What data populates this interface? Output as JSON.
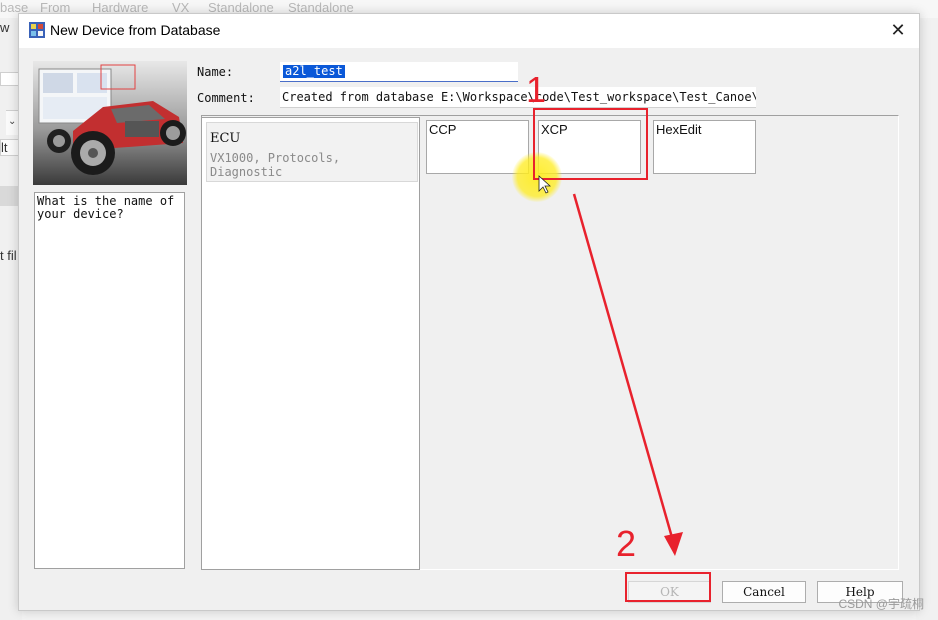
{
  "background_app": {
    "toolbar_items": [
      "base",
      "From",
      "Hardware",
      "VX",
      "Standalone",
      "Standalone"
    ],
    "left_fragments": [
      "w",
      "lt",
      "t fil"
    ]
  },
  "dialog": {
    "title": "New Device from Database",
    "close_glyph": "✕",
    "name_label": "Name:",
    "name_value": "a2l_test",
    "comment_label": "Comment:",
    "comment_value": "Created from database E:\\Workspace\\code\\Test_workspace\\Test_Canoe\\P",
    "help_text": "What is the name of\nyour device?",
    "categories": [
      {
        "title": "ECU",
        "subtitle": "VX1000, Protocols, Diagnostic"
      }
    ],
    "protocols": [
      "CCP",
      "XCP",
      "HexEdit"
    ],
    "buttons": {
      "ok": "OK",
      "cancel": "Cancel",
      "help": "Help"
    }
  },
  "annotations": {
    "marker1": "1",
    "marker2": "2",
    "color": "#e8222d"
  },
  "watermark": "CSDN @宇疏桐"
}
